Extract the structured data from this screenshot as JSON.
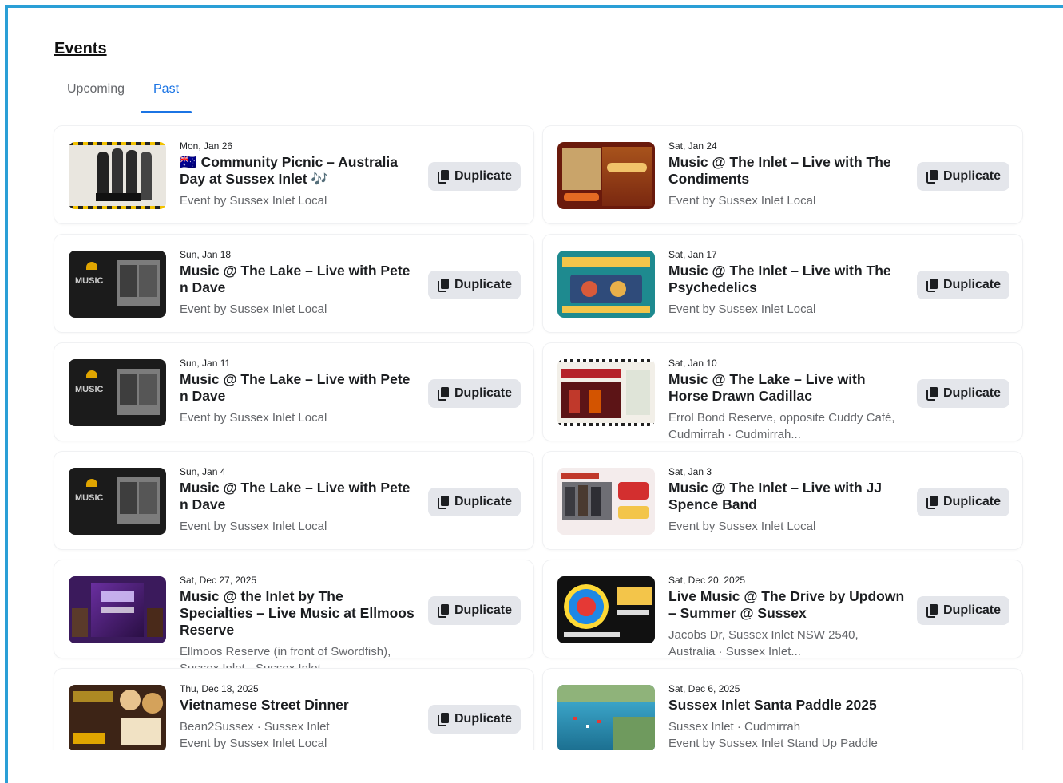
{
  "page": {
    "title": "Events"
  },
  "tabs": [
    {
      "label": "Upcoming"
    },
    {
      "label": "Past"
    }
  ],
  "duplicate_label": "Duplicate",
  "events": [
    {
      "date": "Mon, Jan 26",
      "name": "🇦🇺 Community Picnic – Australia Day at Sussex Inlet 🎶",
      "line1": "Event by Sussex Inlet Local",
      "line2": ""
    },
    {
      "date": "Sat, Jan 24",
      "name": "Music @ The Inlet – Live with The Condiments",
      "line1": "Event by Sussex Inlet Local",
      "line2": ""
    },
    {
      "date": "Sun, Jan 18",
      "name": "Music @ The Lake – Live with Pete n Dave",
      "line1": "Event by Sussex Inlet Local",
      "line2": ""
    },
    {
      "date": "Sat, Jan 17",
      "name": "Music @ The Inlet – Live with The Psychedelics",
      "line1": "Event by Sussex Inlet Local",
      "line2": ""
    },
    {
      "date": "Sun, Jan 11",
      "name": "Music @ The Lake – Live with Pete n Dave",
      "line1": "Event by Sussex Inlet Local",
      "line2": ""
    },
    {
      "date": "Sat, Jan 10",
      "name": "Music @ The Lake – Live with Horse Drawn Cadillac",
      "line1": "Errol Bond Reserve, opposite Cuddy Café,",
      "line2": "Cudmirrah · Cudmirrah..."
    },
    {
      "date": "Sun, Jan 4",
      "name": "Music @ The Lake – Live with Pete n Dave",
      "line1": "Event by Sussex Inlet Local",
      "line2": ""
    },
    {
      "date": "Sat, Jan 3",
      "name": "Music @ The Inlet – Live with JJ Spence Band",
      "line1": "Event by Sussex Inlet Local",
      "line2": ""
    },
    {
      "date": "Sat, Dec 27, 2025",
      "name": "Music @ the Inlet by The Specialties – Live Music at Ellmoos Reserve",
      "line1": "Ellmoos Reserve (in front of Swordfish),",
      "line2": "Sussex Inlet · Sussex Inlet..."
    },
    {
      "date": "Sat, Dec 20, 2025",
      "name": "Live Music @ The Drive by Updown – Summer @ Sussex",
      "line1": "Jacobs Dr, Sussex Inlet NSW 2540,",
      "line2": "Australia · Sussex Inlet..."
    },
    {
      "date": "Thu, Dec 18, 2025",
      "name": "Vietnamese Street Dinner",
      "line1": "Bean2Sussex · Sussex Inlet",
      "line2": "Event by Sussex Inlet Local"
    },
    {
      "date": "Sat, Dec 6, 2025",
      "name": "Sussex Inlet Santa Paddle 2025",
      "line1": "Sussex Inlet · Cudmirrah",
      "line2": "Event by Sussex Inlet Stand Up Paddle"
    }
  ]
}
